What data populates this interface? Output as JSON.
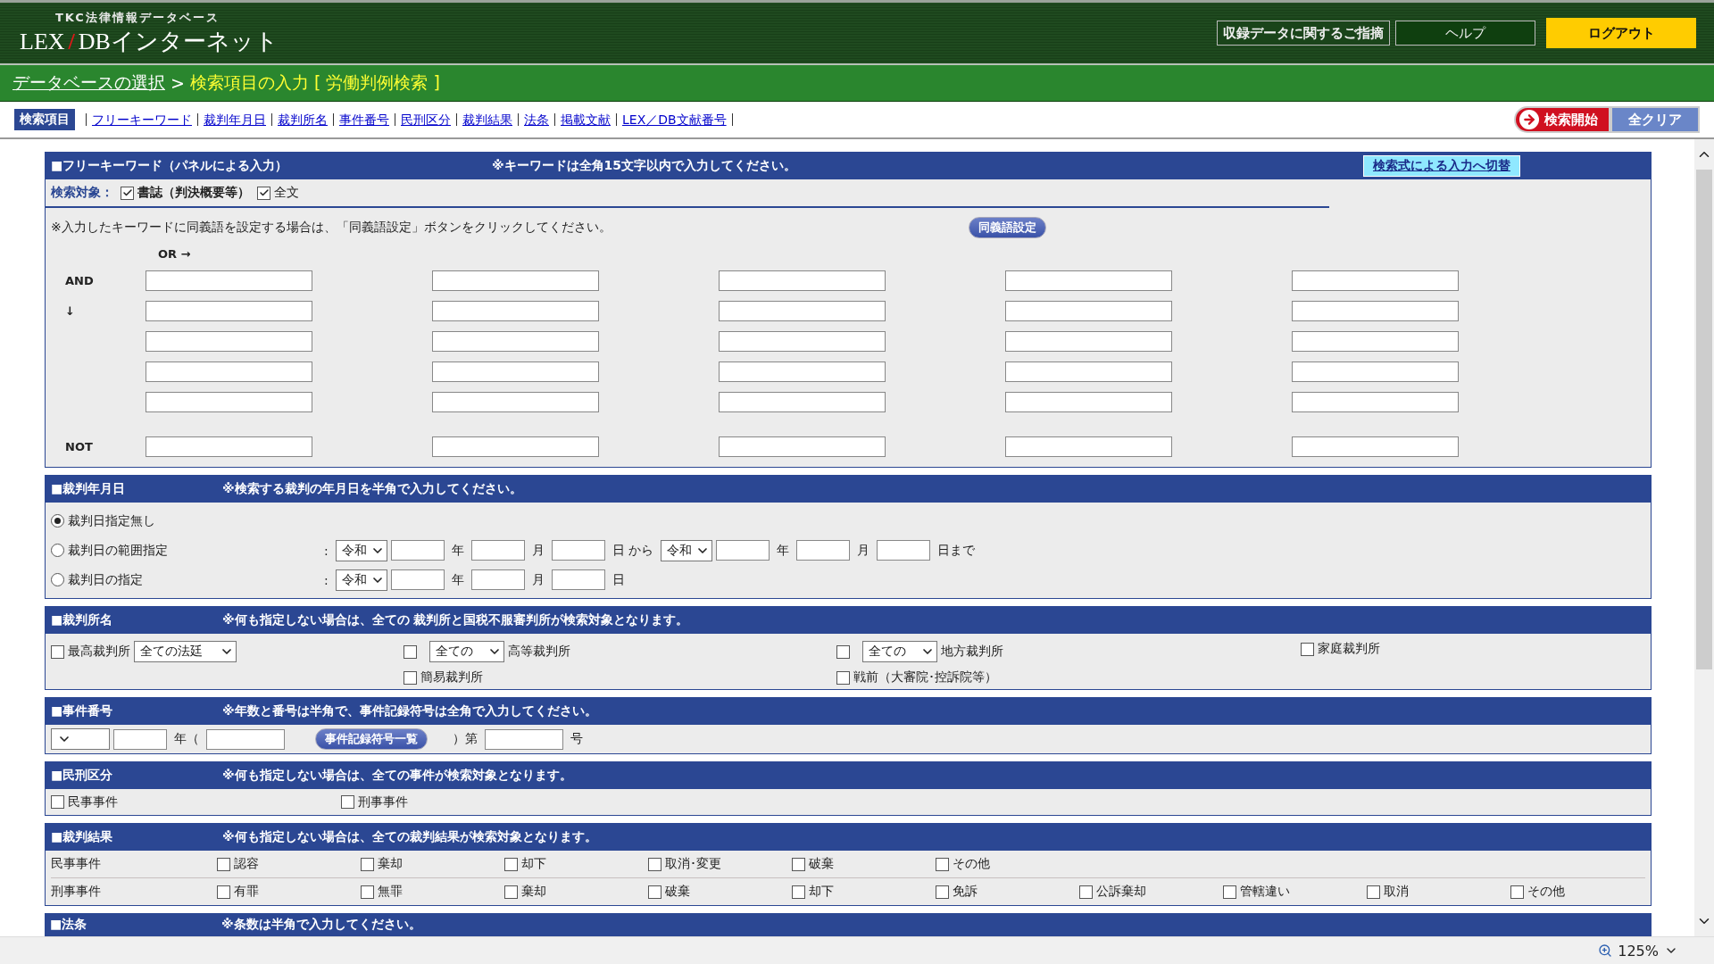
{
  "header": {
    "logo_sub": "TKC法律情報データベース",
    "logo_parts": [
      "LEX",
      "/",
      "DBインターネット"
    ],
    "buttons": [
      {
        "label": "収録データに関するご指摘",
        "kind": "outline"
      },
      {
        "label": "ヘルプ",
        "kind": "dark"
      },
      {
        "label": "ログアウト",
        "kind": "yellow"
      }
    ]
  },
  "breadcrumb": {
    "link": "データベースの選択",
    "separator": ">",
    "current": "検索項目の入力 [ 労働判例検索 ]"
  },
  "nav": {
    "badge": "検索項目",
    "links": [
      "フリーキーワード",
      "裁判年月日",
      "裁判所名",
      "事件番号",
      "民刑区分",
      "裁判結果",
      "法条",
      "掲載文献",
      "LEX／DB文献番号"
    ],
    "actions": [
      {
        "label": "検索開始",
        "kind": "start"
      },
      {
        "label": "全クリア",
        "kind": "clear"
      }
    ]
  },
  "keyword_panel": {
    "title": "■フリーキーワード（パネルによる入力）",
    "note": "※キーワードは全角15文字以内で入力してください。",
    "switch_button": "検索式による入力へ切替",
    "target_label": "検索対象：",
    "targets": [
      {
        "label": "書誌（判決概要等）",
        "checked": true
      },
      {
        "label": "全文",
        "checked": true
      }
    ],
    "synonym_note": "※入力したキーワードに同義語を設定する場合は、「同義語設定」ボタンをクリックしてください。",
    "synonym_button": "同義語設定",
    "or_label": "OR →",
    "rows": [
      {
        "label": "AND",
        "kind": "and"
      },
      {
        "label": "↓",
        "kind": "and"
      },
      {
        "kind": "and"
      },
      {
        "kind": "and"
      },
      {
        "kind": "and"
      },
      {
        "label": "NOT",
        "kind": "not"
      }
    ]
  },
  "date_panel": {
    "title": "■裁判年月日",
    "note": "※検索する裁判の年月日を半角で入力してください。",
    "options": [
      {
        "label": "裁判日指定無し",
        "selected": true
      },
      {
        "label": "裁判日の範囲指定",
        "selected": false,
        "parts": [
          {
            "kind": "text",
            "text": ":"
          },
          {
            "kind": "select",
            "value": "令和"
          },
          {
            "kind": "input"
          },
          {
            "kind": "text",
            "text": "年"
          },
          {
            "kind": "input"
          },
          {
            "kind": "text",
            "text": "月"
          },
          {
            "kind": "input"
          },
          {
            "kind": "text",
            "text": "日 から"
          },
          {
            "kind": "select",
            "value": "令和"
          },
          {
            "kind": "input"
          },
          {
            "kind": "text",
            "text": "年"
          },
          {
            "kind": "input"
          },
          {
            "kind": "text",
            "text": "月"
          },
          {
            "kind": "input"
          },
          {
            "kind": "text",
            "text": "日まで"
          }
        ]
      },
      {
        "label": "裁判日の指定",
        "selected": false,
        "parts": [
          {
            "kind": "text",
            "text": ":"
          },
          {
            "kind": "select",
            "value": "令和"
          },
          {
            "kind": "input"
          },
          {
            "kind": "text",
            "text": "年"
          },
          {
            "kind": "input"
          },
          {
            "kind": "text",
            "text": "月"
          },
          {
            "kind": "input"
          },
          {
            "kind": "text",
            "text": "日"
          }
        ]
      }
    ]
  },
  "court_panel": {
    "title": "■裁判所名",
    "note": "※何も指定しない場合は、全ての 裁判所と国税不服審判所が検索対象となります。",
    "columns": [
      [
        {
          "label": "最高裁判所",
          "checked": false,
          "kind": "label-select",
          "select": "全ての法廷"
        }
      ],
      [
        {
          "label": "高等裁判所",
          "checked": false,
          "kind": "select-label",
          "select": "全ての"
        },
        {
          "label": "簡易裁判所",
          "checked": false,
          "kind": "plain"
        }
      ],
      [
        {
          "label": "地方裁判所",
          "checked": false,
          "kind": "select-label",
          "select": "全ての"
        },
        {
          "label": "戦前（大審院･控訴院等）",
          "checked": false,
          "kind": "plain"
        }
      ],
      [
        {
          "label": "家庭裁判所",
          "checked": false,
          "kind": "plain"
        }
      ]
    ]
  },
  "case_panel": {
    "title": "■事件番号",
    "note": "※年数と番号は半角で、事件記録符号は全角で入力してください。",
    "parts": [
      {
        "kind": "select"
      },
      {
        "kind": "input"
      },
      {
        "kind": "text",
        "text": "年（"
      },
      {
        "kind": "input-wide"
      },
      {
        "kind": "button",
        "text": "事件記録符号一覧"
      },
      {
        "kind": "text",
        "text": "）第"
      },
      {
        "kind": "input-wide"
      },
      {
        "kind": "text",
        "text": "号"
      }
    ]
  },
  "type_panel": {
    "title": "■民刑区分",
    "note": "※何も指定しない場合は、全ての事件が検索対象となります。",
    "options": [
      {
        "label": "民事事件",
        "checked": false
      },
      {
        "label": "刑事事件",
        "checked": false
      }
    ]
  },
  "result_panel": {
    "title": "■裁判結果",
    "note": "※何も指定しない場合は、全ての裁判結果が検索対象となります。",
    "rows": [
      {
        "label": "民事事件",
        "options": [
          {
            "label": "認容",
            "checked": false
          },
          {
            "label": "棄却",
            "checked": false
          },
          {
            "label": "却下",
            "checked": false
          },
          {
            "label": "取消･変更",
            "checked": false
          },
          {
            "label": "破棄",
            "checked": false
          },
          {
            "label": "その他",
            "checked": false
          }
        ]
      },
      {
        "label": "刑事事件",
        "options": [
          {
            "label": "有罪",
            "checked": false
          },
          {
            "label": "無罪",
            "checked": false
          },
          {
            "label": "棄却",
            "checked": false
          },
          {
            "label": "破棄",
            "checked": false
          },
          {
            "label": "却下",
            "checked": false
          },
          {
            "label": "免訴",
            "checked": false
          },
          {
            "label": "公訴棄却",
            "checked": false
          },
          {
            "label": "管轄違い",
            "checked": false
          },
          {
            "label": "取消",
            "checked": false
          },
          {
            "label": "その他",
            "checked": false
          }
        ]
      }
    ]
  },
  "law_panel": {
    "title": "■法条",
    "note": "※条数は半角で入力してください。"
  },
  "status_bar": {
    "zoom": "125%"
  }
}
